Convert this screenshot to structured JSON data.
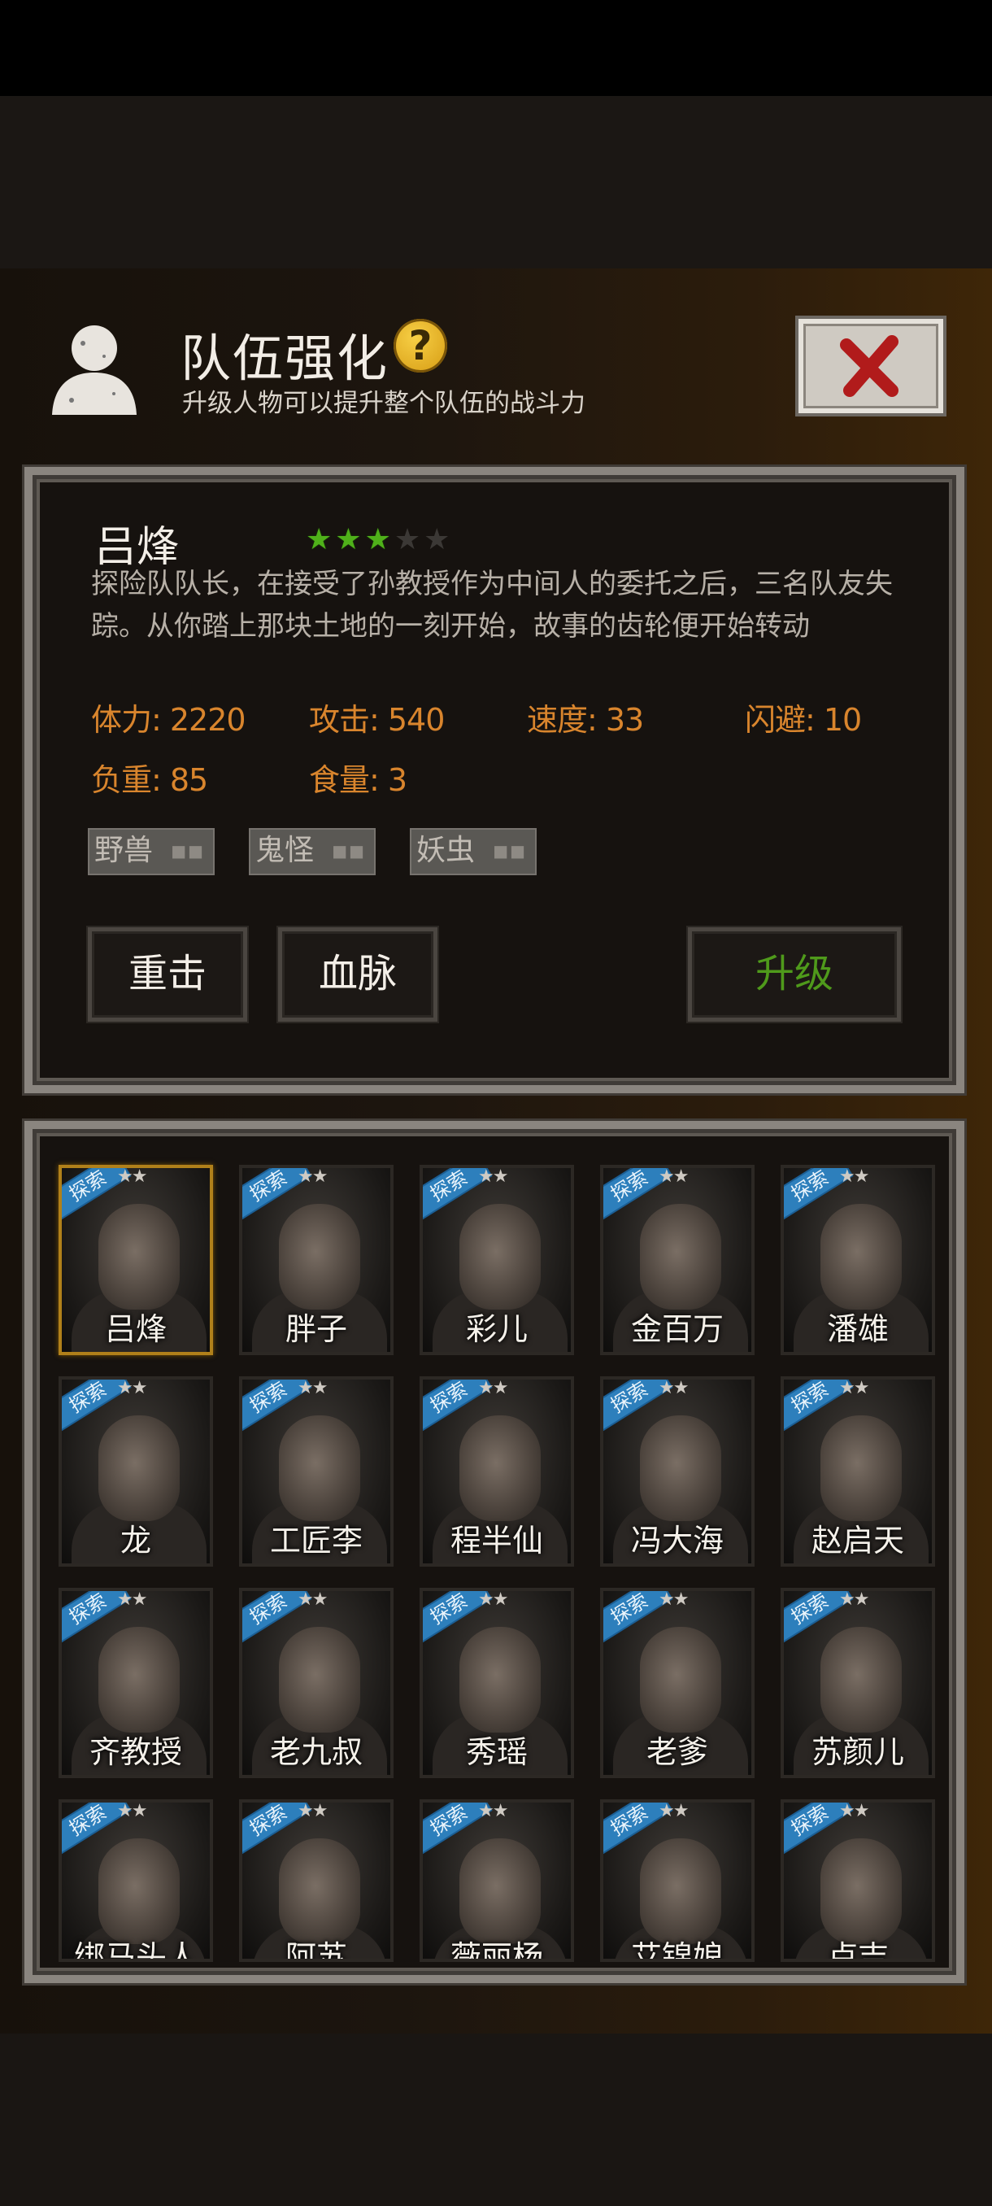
{
  "header": {
    "title": "队伍强化",
    "subtitle": "升级人物可以提升整个队伍的战斗力",
    "help_symbol": "?"
  },
  "hero": {
    "name": "吕烽",
    "stars_filled": 3,
    "stars_total": 5,
    "description": "探险队队长，在接受了孙教授作为中间人的委托之后，三名队友失踪。从你踏上那块土地的一刻开始，故事的齿轮便开始转动",
    "stats": [
      {
        "label": "体力: 2220"
      },
      {
        "label": "攻击: 540"
      },
      {
        "label": "速度: 33"
      },
      {
        "label": "闪避: 10"
      },
      {
        "label": "负重: 85"
      },
      {
        "label": "食量: 3"
      }
    ],
    "tags": [
      "野兽",
      "鬼怪",
      "妖虫"
    ],
    "buttons": {
      "skill1": "重击",
      "skill2": "血脉",
      "upgrade": "升级"
    }
  },
  "roster": {
    "badge_text": "探索",
    "star_glyph": "★★",
    "characters": [
      {
        "name": "吕烽",
        "selected": true
      },
      {
        "name": "胖子"
      },
      {
        "name": "彩儿"
      },
      {
        "name": "金百万"
      },
      {
        "name": "潘雄"
      },
      {
        "name": "龙"
      },
      {
        "name": "工匠李"
      },
      {
        "name": "程半仙"
      },
      {
        "name": "冯大海"
      },
      {
        "name": "赵启天"
      },
      {
        "name": "齐教授"
      },
      {
        "name": "老九叔"
      },
      {
        "name": "秀瑶"
      },
      {
        "name": "老爹"
      },
      {
        "name": "苏颜儿"
      },
      {
        "name": "绑马头人"
      },
      {
        "name": "阿苏"
      },
      {
        "name": "薇丽杨"
      },
      {
        "name": "艾锦娘"
      },
      {
        "name": "卢吉"
      }
    ]
  },
  "colors": {
    "stat_orange": "#d9852d",
    "upgrade_green": "#4f9a1b",
    "star_green": "#4fb11a",
    "badge_blue": "#2d7fbc"
  }
}
